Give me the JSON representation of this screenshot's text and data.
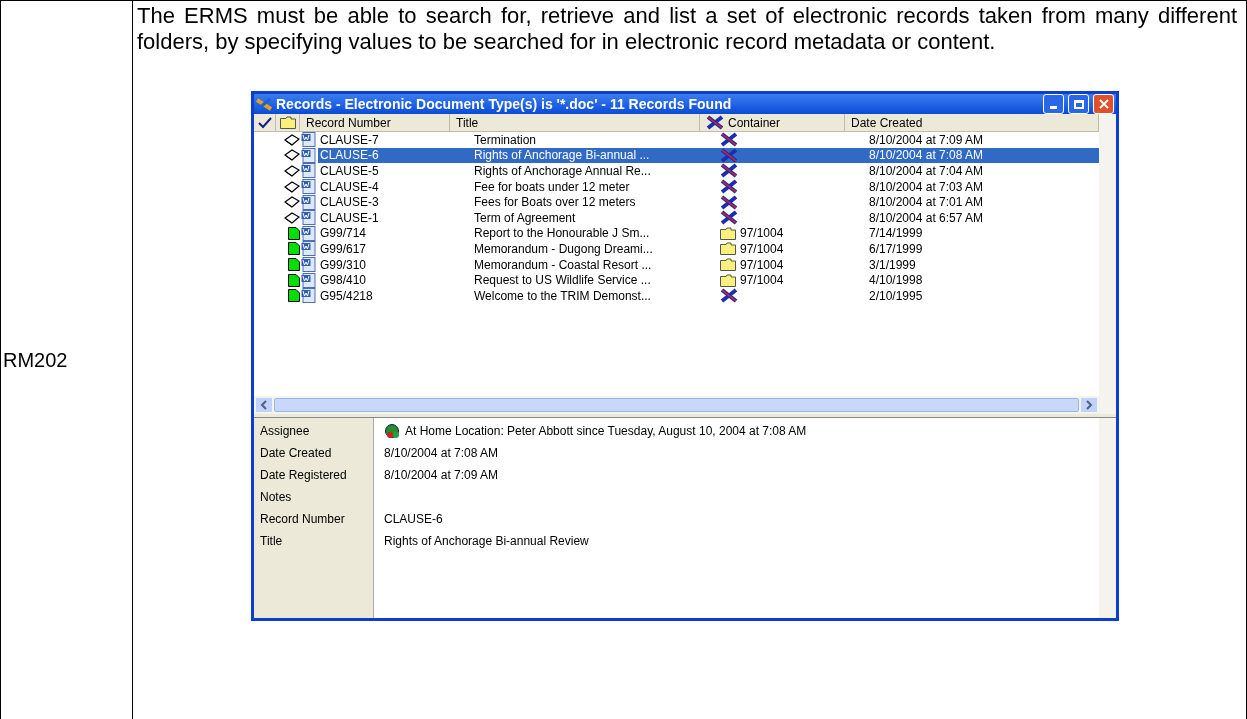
{
  "requirement": {
    "id": "RM202",
    "text": "The ERMS must be able to search for, retrieve and list a set of electronic records taken from many different folders, by specifying values to be searched for in electronic record metadata or content."
  },
  "window": {
    "title": "Records - Electronic Document Type(s) is '*.doc' - 11 Records Found"
  },
  "columns": [
    "Record Number",
    "Title",
    "Container",
    "Date Created"
  ],
  "rows": [
    {
      "kind": "clause",
      "record_number": "CLAUSE-7",
      "title": "Termination",
      "container": {
        "kind": "none"
      },
      "date_created": "8/10/2004 at 7:09 AM",
      "selected": false
    },
    {
      "kind": "clause",
      "record_number": "CLAUSE-6",
      "title": "Rights of Anchorage Bi-annual ...",
      "container": {
        "kind": "none"
      },
      "date_created": "8/10/2004 at 7:08 AM",
      "selected": true
    },
    {
      "kind": "clause",
      "record_number": "CLAUSE-5",
      "title": "Rights of Anchorage Annual Re...",
      "container": {
        "kind": "none"
      },
      "date_created": "8/10/2004 at 7:04 AM",
      "selected": false
    },
    {
      "kind": "clause",
      "record_number": "CLAUSE-4",
      "title": "Fee for boats under 12 meter",
      "container": {
        "kind": "none"
      },
      "date_created": "8/10/2004 at 7:03 AM",
      "selected": false
    },
    {
      "kind": "clause",
      "record_number": "CLAUSE-3",
      "title": "Fees for Boats over 12 meters",
      "container": {
        "kind": "none"
      },
      "date_created": "8/10/2004 at 7:01 AM",
      "selected": false
    },
    {
      "kind": "clause",
      "record_number": "CLAUSE-1",
      "title": "Term of Agreement",
      "container": {
        "kind": "none"
      },
      "date_created": "8/10/2004 at 6:57 AM",
      "selected": false
    },
    {
      "kind": "record",
      "record_number": "G99/714",
      "title": "Report to the Honourable J Sm...",
      "container": {
        "kind": "folder",
        "text": "97/1004"
      },
      "date_created": "7/14/1999",
      "selected": false
    },
    {
      "kind": "record",
      "record_number": "G99/617",
      "title": "Memorandum - Dugong Dreami...",
      "container": {
        "kind": "folder",
        "text": "97/1004"
      },
      "date_created": "6/17/1999",
      "selected": false
    },
    {
      "kind": "record",
      "record_number": "G99/310",
      "title": "Memorandum - Coastal Resort ...",
      "container": {
        "kind": "folder",
        "text": "97/1004"
      },
      "date_created": "3/1/1999",
      "selected": false
    },
    {
      "kind": "record",
      "record_number": "G98/410",
      "title": "Request to US Wildlife Service ...",
      "container": {
        "kind": "folder",
        "text": "97/1004"
      },
      "date_created": "4/10/1998",
      "selected": false
    },
    {
      "kind": "record",
      "record_number": "G95/4218",
      "title": "Welcome to the TRIM Demonst...",
      "container": {
        "kind": "none"
      },
      "date_created": "2/10/1995",
      "selected": false
    }
  ],
  "details": [
    {
      "label": "Assignee",
      "value": "At Home Location: Peter Abbott since Tuesday, August 10, 2004 at 7:08 AM",
      "kind": "location"
    },
    {
      "label": "Date Created",
      "value": "8/10/2004 at 7:08 AM",
      "kind": "text"
    },
    {
      "label": "Date Registered",
      "value": "8/10/2004 at 7:09 AM",
      "kind": "text"
    },
    {
      "label": "Notes",
      "kind": "text"
    },
    {
      "label": "Record Number",
      "value": "CLAUSE-6",
      "kind": "text"
    },
    {
      "label": "Title",
      "value": "Rights of Anchorage Bi-annual Review",
      "kind": "text"
    }
  ]
}
